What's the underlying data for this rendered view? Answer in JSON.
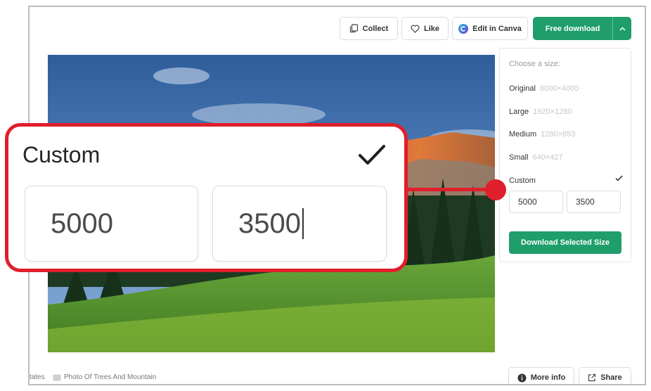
{
  "toolbar": {
    "collect_label": "Collect",
    "like_label": "Like",
    "canva_label": "Edit in Canva",
    "download_label": "Free download"
  },
  "size_panel": {
    "title": "Choose a size:",
    "options": [
      {
        "label": "Original",
        "dims": "6000×4000"
      },
      {
        "label": "Large",
        "dims": "1920×1280"
      },
      {
        "label": "Medium",
        "dims": "1280×853"
      },
      {
        "label": "Small",
        "dims": "640×427"
      }
    ],
    "custom_label": "Custom",
    "custom_width": "5000",
    "custom_height": "3500",
    "download_selected_label": "Download Selected Size"
  },
  "footer": {
    "tag_left": "tates",
    "photo_title": "Photo Of Trees And Mountain",
    "more_info_label": "More info",
    "share_label": "Share"
  },
  "callout": {
    "title": "Custom",
    "width_value": "5000",
    "height_value": "3500"
  },
  "colors": {
    "accent_green": "#1f9e6c",
    "highlight_red": "#e01e2c"
  },
  "icons": {
    "collect": "copy-icon",
    "like": "heart-icon",
    "canva": "canva-logo-icon",
    "download_menu": "chevron-up-icon",
    "selected": "checkmark-icon",
    "info": "info-icon",
    "share": "share-icon"
  }
}
